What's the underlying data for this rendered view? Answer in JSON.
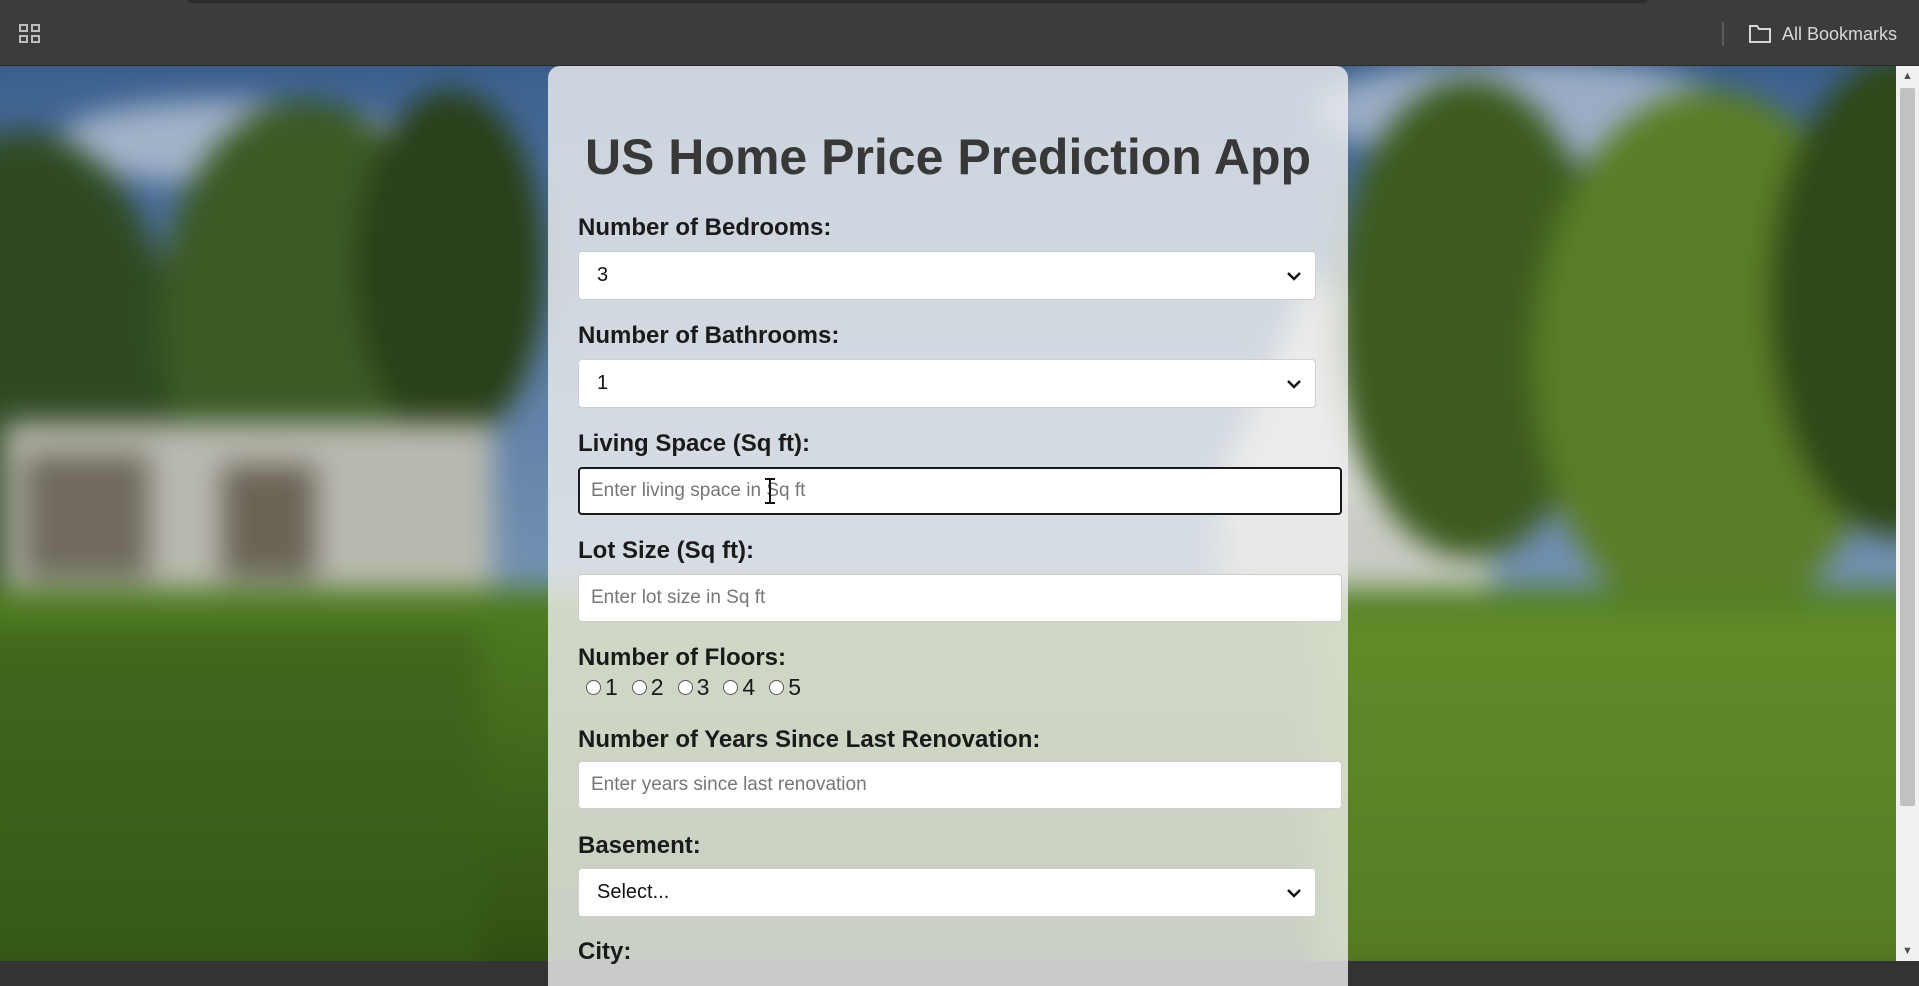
{
  "browser": {
    "apps_icon": "apps-grid-icon",
    "bookmarks_icon": "folder-icon",
    "bookmarks_label": "All Bookmarks"
  },
  "app": {
    "title": "US Home Price Prediction App"
  },
  "form": {
    "bedrooms": {
      "label": "Number of Bedrooms:",
      "value": "3"
    },
    "bathrooms": {
      "label": "Number of Bathrooms:",
      "value": "1"
    },
    "living_space": {
      "label": "Living Space (Sq ft):",
      "placeholder": "Enter living space in Sq ft",
      "value": ""
    },
    "lot_size": {
      "label": "Lot Size (Sq ft):",
      "placeholder": "Enter lot size in Sq ft",
      "value": ""
    },
    "floors": {
      "label": "Number of Floors:",
      "options": [
        "1",
        "2",
        "3",
        "4",
        "5"
      ],
      "selected": null
    },
    "renovation": {
      "label": "Number of Years Since Last Renovation:",
      "placeholder": "Enter years since last renovation",
      "value": ""
    },
    "basement": {
      "label": "Basement:",
      "value": "Select..."
    },
    "city": {
      "label": "City:"
    }
  },
  "colors": {
    "chrome": "#3c3c3c",
    "title": "#383838",
    "card": "rgba(240,240,240,0.80)"
  }
}
